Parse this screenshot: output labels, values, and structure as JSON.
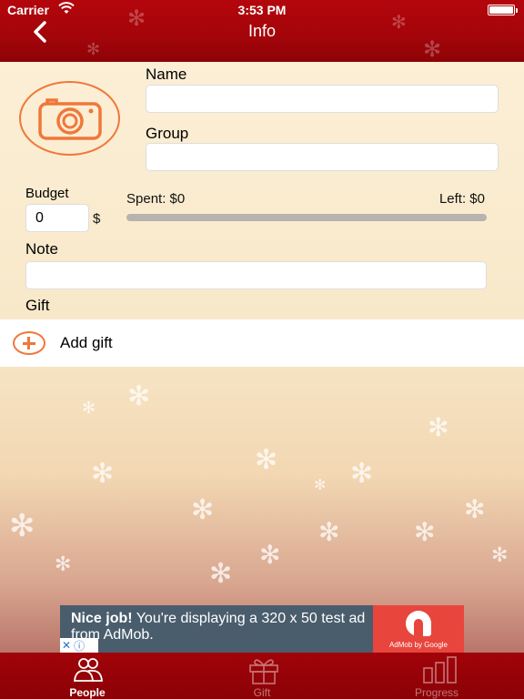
{
  "status_bar": {
    "carrier": "Carrier",
    "time": "3:53 PM"
  },
  "nav": {
    "title": "Info",
    "back_icon": "chevron-left-icon"
  },
  "form": {
    "name_label": "Name",
    "name_value": "",
    "group_label": "Group",
    "group_value": "",
    "budget_label": "Budget",
    "budget_value": "0",
    "currency": "$",
    "spent": "Spent: $0",
    "left": "Left: $0",
    "budget_progress": 0,
    "note_label": "Note",
    "note_value": "",
    "gift_label": "Gift",
    "add_gift": "Add gift"
  },
  "ad": {
    "headline": "Nice job!",
    "body": " You're displaying a 320 x 50 test ad from AdMob.",
    "logo_text": "AdMob by Google",
    "close_symbol": "✕",
    "info_symbol": "ⓘ"
  },
  "tabs": [
    {
      "label": "People",
      "icon": "people-icon",
      "active": true
    },
    {
      "label": "Gift",
      "icon": "gift-icon",
      "active": false
    },
    {
      "label": "Progress",
      "icon": "bar-chart-icon",
      "active": false
    }
  ],
  "colors": {
    "nav_red": "#a3050a",
    "accent_orange": "#f0773a",
    "ad_bg": "#4a5d6d",
    "admob_red": "#e8453c"
  }
}
